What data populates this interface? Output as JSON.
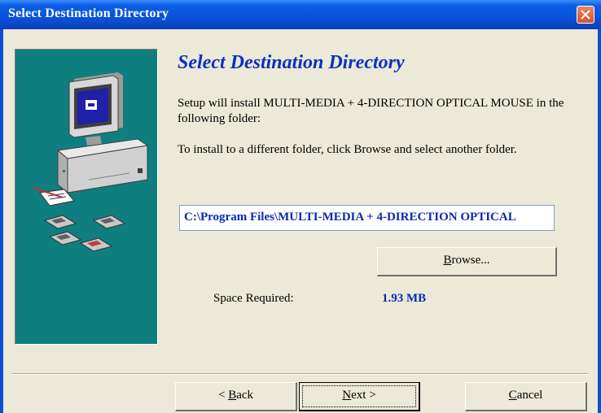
{
  "window": {
    "title": "Select Destination Directory",
    "close_icon": "close-icon"
  },
  "main": {
    "heading": "Select Destination Directory",
    "description": "Setup will install MULTI-MEDIA + 4-DIRECTION OPTICAL MOUSE in the following folder:",
    "instruction": "To install to a different folder, click Browse and select another folder.",
    "path_value": "C:\\Program Files\\MULTI-MEDIA + 4-DIRECTION OPTICAL",
    "browse": {
      "mnemonic": "B",
      "rest": "rowse..."
    },
    "space_label": "Space Required:",
    "space_value": "1.93 MB"
  },
  "footer": {
    "back": {
      "prefix": "< ",
      "mnemonic": "B",
      "rest": "ack"
    },
    "next": {
      "mnemonic": "N",
      "rest": "ext >"
    },
    "cancel": {
      "mnemonic": "C",
      "rest": "ancel"
    }
  },
  "colors": {
    "title_bar": "#0a4fd6",
    "side_panel": "#0f7e7e",
    "heading": "#0a30c0",
    "value_text": "#0a2ab0",
    "dialog_bg": "#ece9d8"
  },
  "icons": [
    "close-icon",
    "computer-icon",
    "document-icon",
    "floppy-disk-icon"
  ]
}
